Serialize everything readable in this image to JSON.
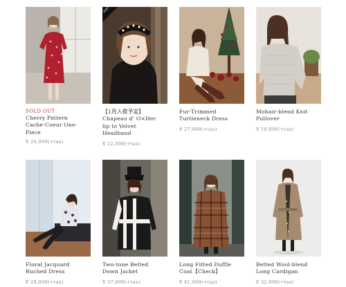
{
  "products": [
    {
      "status": "",
      "name": "Chapeau d’ O×Her lip to Velvet Headband",
      "name_lines": [
        "【1月入荷予定】",
        "Chapeau d’ O×Her",
        "lip to Velvet",
        "Headband"
      ],
      "price": "¥ 12,000(+tax)",
      "badge": "HOT"
    },
    {
      "status": "SOLD OUT",
      "name": "Cherry Pattern Cache-Coeur One-Piece",
      "name_lines": [
        "Cherry Pattern",
        "Cache-Coeur One-",
        "Piece"
      ],
      "price": "¥ 24,000(+tax)"
    },
    {
      "status": "",
      "name": "Fur-Trimmed Turtleneck Dress",
      "name_lines": [
        "Fur-Trimmed",
        "Turtleneck Dress"
      ],
      "price": "¥ 27,000(+tax)"
    },
    {
      "status": "",
      "name": "Mohair-blend Knit Pullover",
      "name_lines": [
        "Mohair-blend Knit",
        "Pullover"
      ],
      "price": "¥ 16,000(+tax)"
    },
    {
      "status": "",
      "name": "Floral Jacquard Ruched Dress",
      "name_lines": [
        "Floral Jacquard",
        "Ruched Dress"
      ],
      "price": "¥ 28,000(+tax)"
    },
    {
      "status": "",
      "name": "Two-tone Belted Down Jacket",
      "name_lines": [
        "Two-tone Belted",
        "Down Jacket"
      ],
      "price": "¥ 37,000(+tax)"
    },
    {
      "status": "",
      "name": "Long Fitted Duffle Coat【Check】",
      "name_lines": [
        "Long Fitted Duffle",
        "Coat【Check】"
      ],
      "price": "¥ 41,000(+tax)"
    },
    {
      "status": "",
      "name": "Belted Wool-blend Long Cardigan",
      "name_lines": [
        "Belted Wool-blend",
        "Long Cardigan"
      ],
      "price": "¥ 32,000(+tax)"
    }
  ]
}
